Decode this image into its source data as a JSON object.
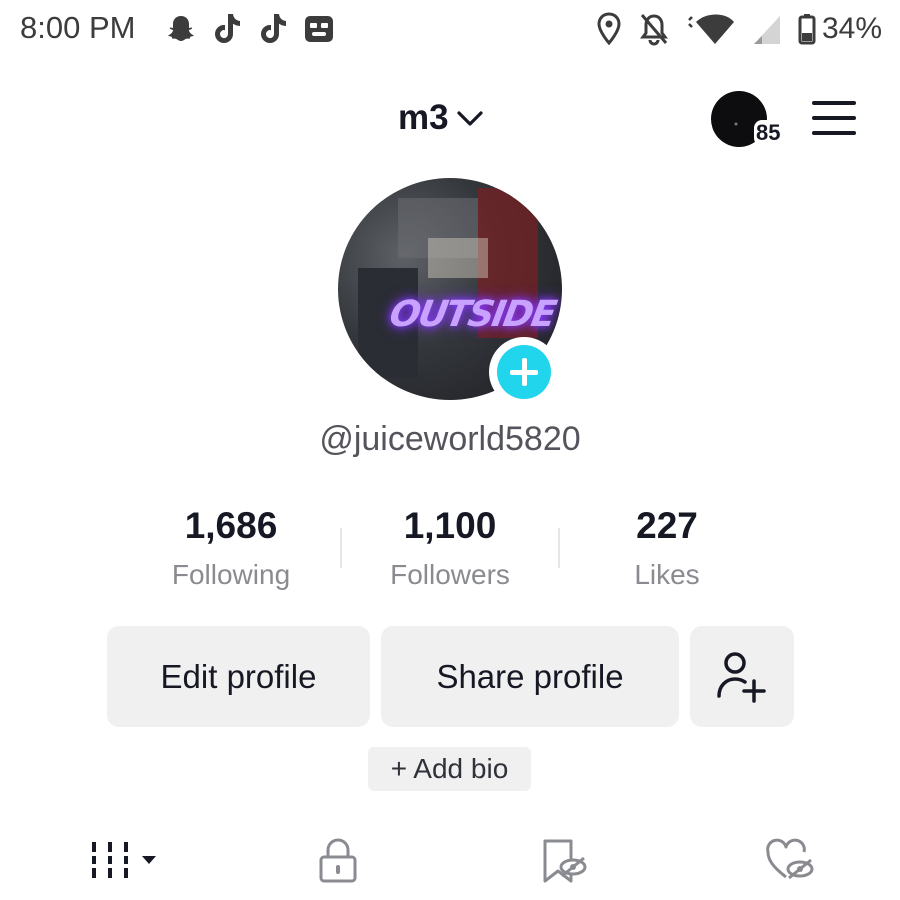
{
  "status_bar": {
    "time": "8:00 PM",
    "left_icons": [
      "snapchat-icon",
      "tiktok-icon",
      "tiktok-icon",
      "bot-app-icon"
    ],
    "right_icons": [
      "location-icon",
      "notifications-off-icon",
      "wifi-icon",
      "signal-icon",
      "battery-icon"
    ],
    "battery": "34%"
  },
  "header": {
    "username": "m3",
    "inbox_count": "85"
  },
  "profile": {
    "avatar_text": "OUTSIDE",
    "handle": "@juiceworld5820"
  },
  "stats": [
    {
      "value": "1,686",
      "label": "Following"
    },
    {
      "value": "1,100",
      "label": "Followers"
    },
    {
      "value": "227",
      "label": "Likes"
    }
  ],
  "actions": {
    "edit_profile": "Edit profile",
    "share_profile": "Share profile",
    "add_bio": "+ Add bio"
  },
  "tabs": [
    {
      "icon": "grid-icon",
      "active": true
    },
    {
      "icon": "lock-icon",
      "active": false
    },
    {
      "icon": "bookmark-hidden-icon",
      "active": false
    },
    {
      "icon": "heart-hidden-icon",
      "active": false
    }
  ],
  "colors": {
    "accent": "#20d5ec",
    "text_primary": "#161823",
    "text_secondary": "#8a8b91",
    "button_bg": "#f0f0f1"
  }
}
